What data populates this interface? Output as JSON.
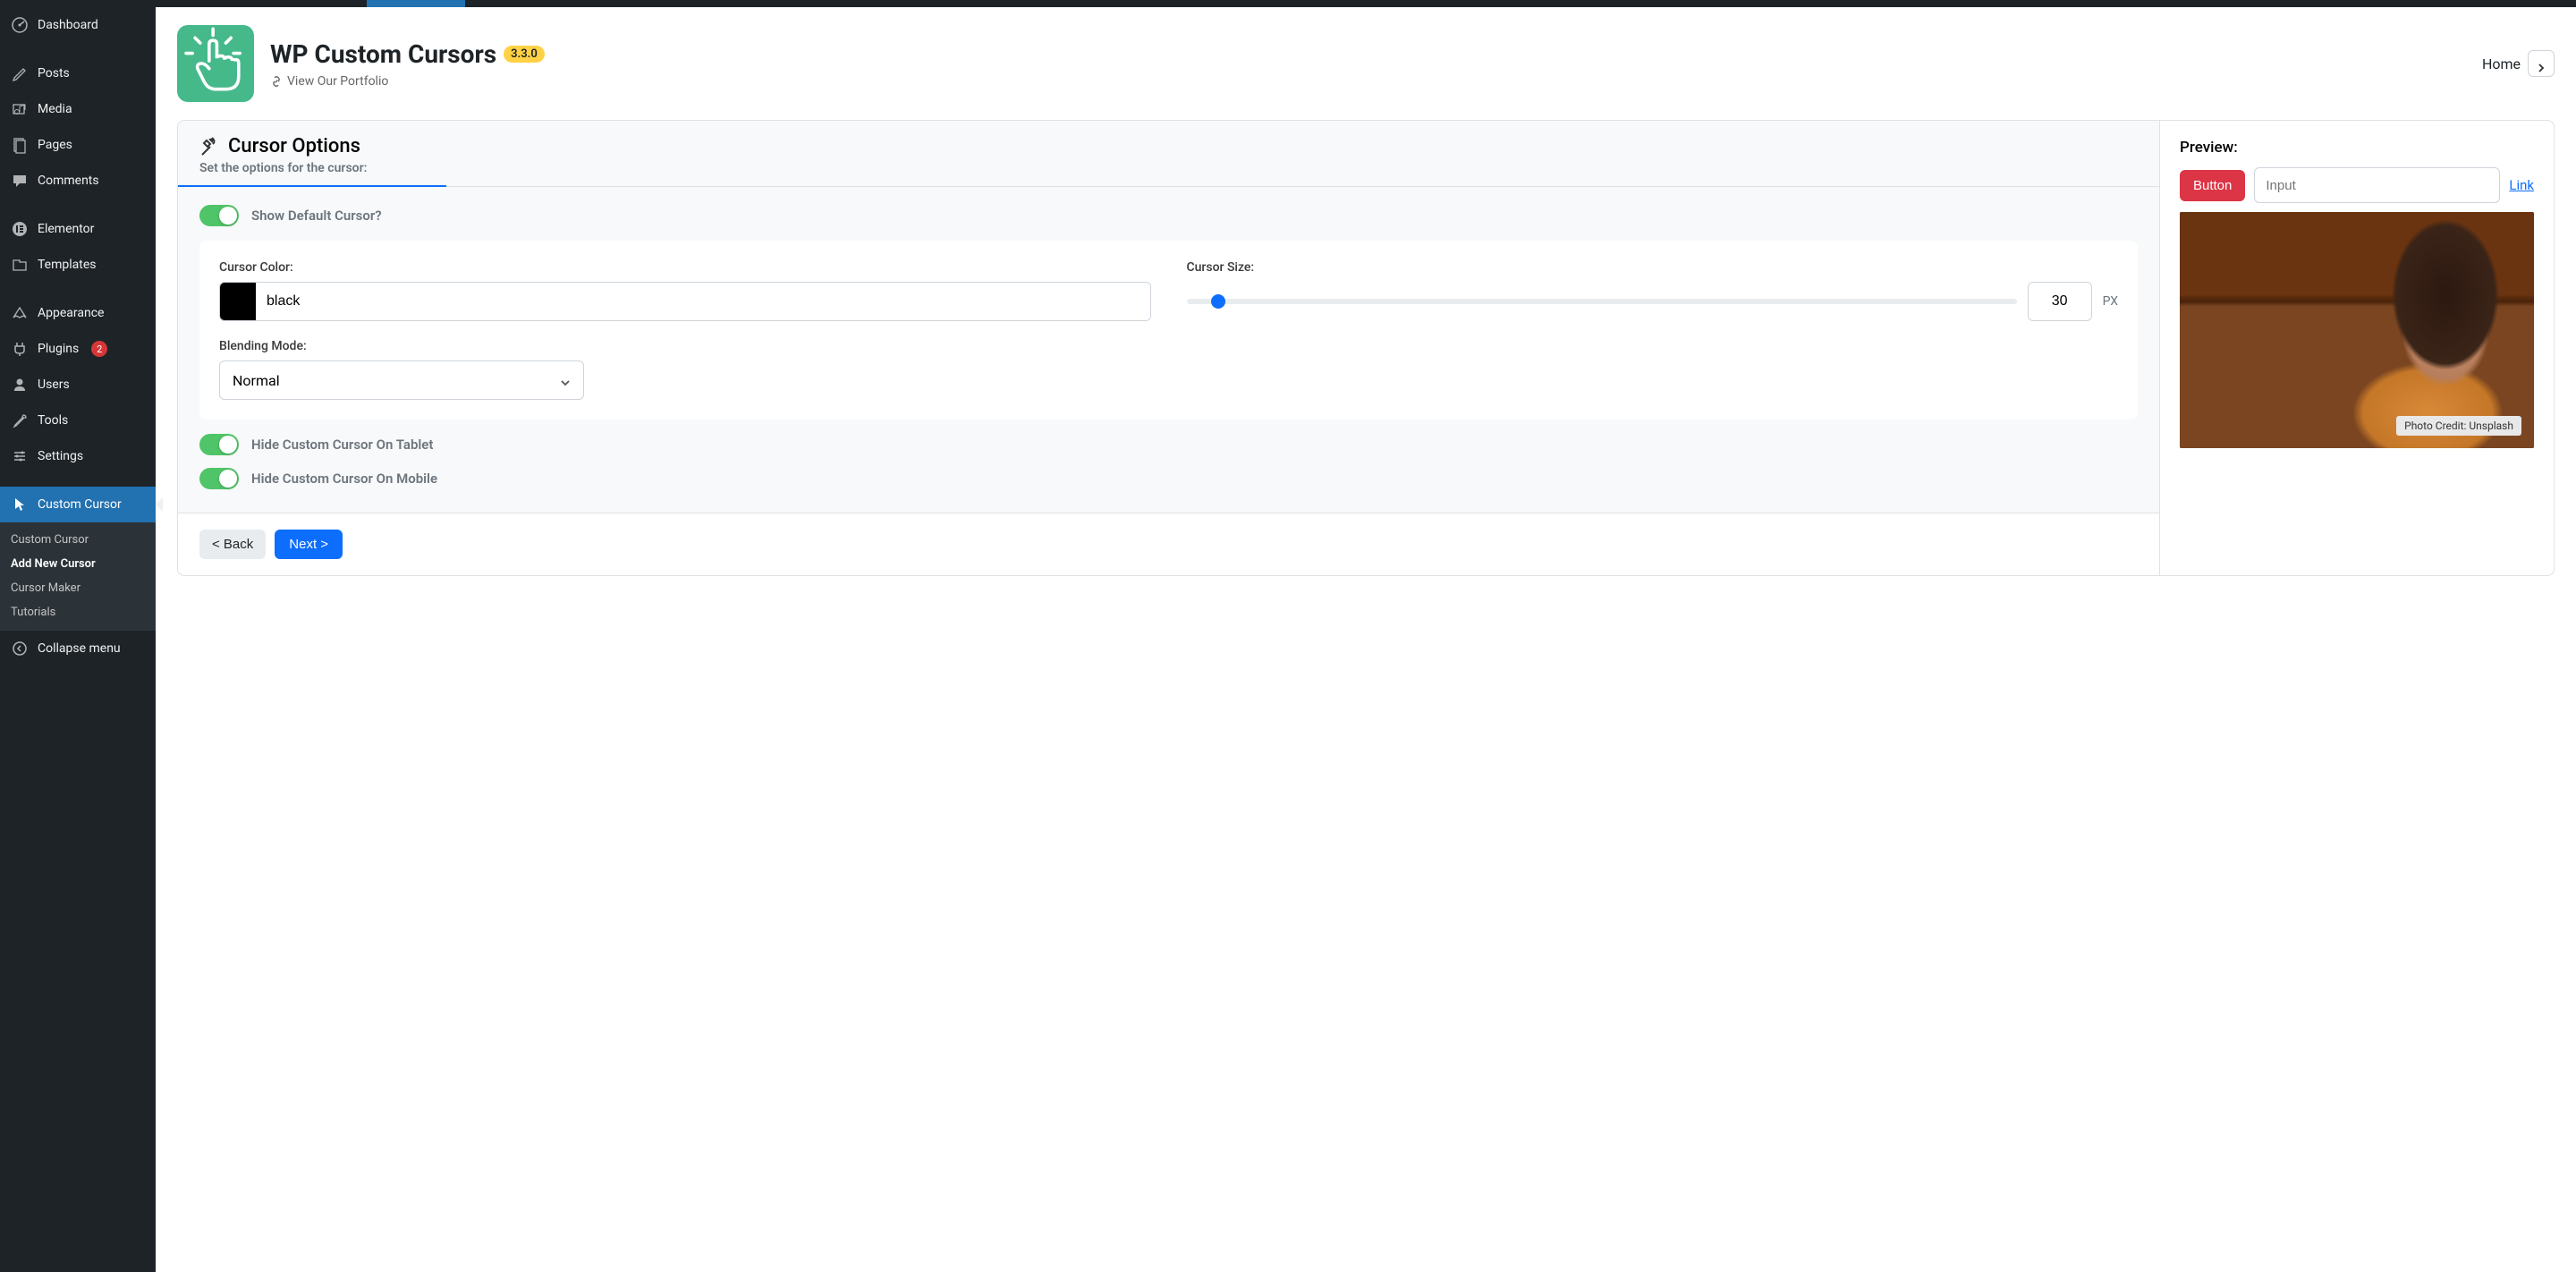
{
  "sidebar": {
    "dashboard": "Dashboard",
    "posts": "Posts",
    "media": "Media",
    "pages": "Pages",
    "comments": "Comments",
    "elementor": "Elementor",
    "templates": "Templates",
    "appearance": "Appearance",
    "plugins": "Plugins",
    "plugins_badge": "2",
    "users": "Users",
    "tools": "Tools",
    "settings": "Settings",
    "custom_cursor": "Custom Cursor",
    "sub": {
      "custom_cursor": "Custom Cursor",
      "add_new": "Add New Cursor",
      "cursor_maker": "Cursor Maker",
      "tutorials": "Tutorials"
    },
    "collapse": "Collapse menu"
  },
  "header": {
    "title": "WP Custom Cursors",
    "version": "3.3.0",
    "portfolio": "View Our Portfolio",
    "home": "Home"
  },
  "options": {
    "section_title": "Cursor Options",
    "section_sub": "Set the options for the cursor:",
    "show_default": "Show Default Cursor?",
    "cursor_color_label": "Cursor Color:",
    "cursor_color_value": "black",
    "cursor_size_label": "Cursor Size:",
    "cursor_size_value": "30",
    "px": "PX",
    "blending_label": "Blending Mode:",
    "blending_value": "Normal",
    "hide_tablet": "Hide Custom Cursor On Tablet",
    "hide_mobile": "Hide Custom Cursor On Mobile",
    "back": "< Back",
    "next": "Next >"
  },
  "preview": {
    "title": "Preview:",
    "button": "Button",
    "input_placeholder": "Input",
    "link": "Link",
    "credit": "Photo Credit: Unsplash"
  }
}
